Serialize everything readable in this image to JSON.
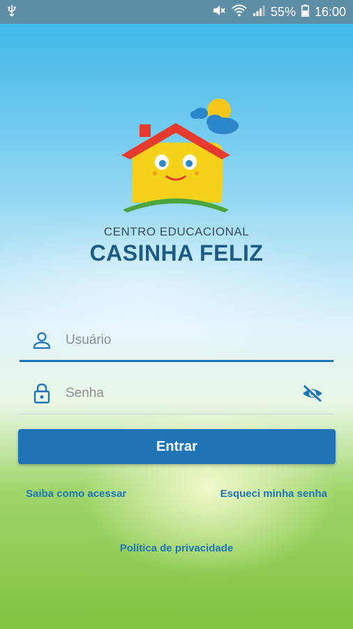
{
  "statusbar": {
    "battery": "55%",
    "time": "16:00",
    "icons": [
      "usb-icon",
      "mute-icon",
      "wifi-icon",
      "signal-icon",
      "battery-icon"
    ]
  },
  "brand": {
    "line1": "CENTRO EDUCACIONAL",
    "line2": "CASINHA FELIZ"
  },
  "login": {
    "username_placeholder": "Usuário",
    "username_value": "",
    "password_placeholder": "Senha",
    "password_value": "",
    "submit_label": "Entrar"
  },
  "links": {
    "how_to_access": "Saiba como acessar",
    "forgot_password": "Esqueci minha senha",
    "privacy": "Política de privacidade"
  },
  "colors": {
    "primary": "#1f74b8",
    "brand_text": "#1c5b86",
    "statusbar": "#5d8da7"
  }
}
